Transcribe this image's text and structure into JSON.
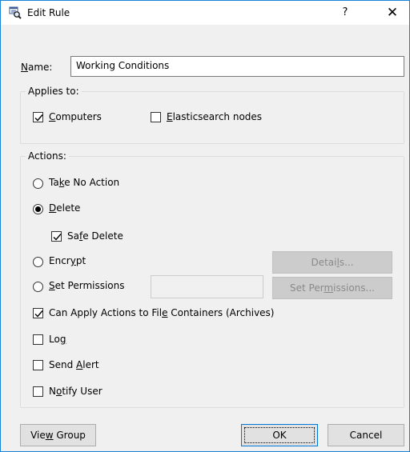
{
  "window": {
    "title": "Edit Rule",
    "help": "?",
    "close": "✕"
  },
  "name": {
    "label_u": "N",
    "label_rest": "ame:",
    "value": "Working Conditions"
  },
  "applies_to": {
    "legend": "Applies to:",
    "computers": {
      "u": "C",
      "rest": "omputers",
      "checked": true
    },
    "elasticsearch": {
      "u": "E",
      "rest": "lasticsearch nodes",
      "checked": false
    }
  },
  "actions": {
    "legend": "Actions:",
    "take_no_action": {
      "pre": "Ta",
      "u": "k",
      "post": "e No Action"
    },
    "delete": {
      "pre": "",
      "u": "D",
      "post": "elete"
    },
    "safe_delete": {
      "pre": "Sa",
      "u": "f",
      "post": "e Delete"
    },
    "encrypt": {
      "pre": "Encr",
      "u": "y",
      "post": "pt"
    },
    "set_permissions": {
      "pre": "",
      "u": "S",
      "post": "et Permissions"
    },
    "details_button": {
      "pre": "Detai",
      "u": "l",
      "post": "s..."
    },
    "set_permissions_button": {
      "pre": "Set Per",
      "u": "m",
      "post": "issions..."
    },
    "can_apply": {
      "pre": "Can Apply Actions to Fil",
      "u": "e",
      "post": " Containers (Archives)"
    },
    "log": {
      "pre": "Lo",
      "u": "g",
      "post": ""
    },
    "send_alert": {
      "pre": "Send ",
      "u": "A",
      "post": "lert"
    },
    "notify_user": {
      "pre": "N",
      "u": "o",
      "post": "tify User"
    }
  },
  "footer": {
    "view_group": {
      "pre": "Vie",
      "u": "w",
      "post": " Group"
    },
    "ok": "OK",
    "cancel": "Cancel"
  },
  "colors": {
    "window_border": "#1883d7",
    "dialog_bg": "#f0f0f0",
    "default_button_border": "#0078d7",
    "disabled_text": "#8a8a8a"
  }
}
